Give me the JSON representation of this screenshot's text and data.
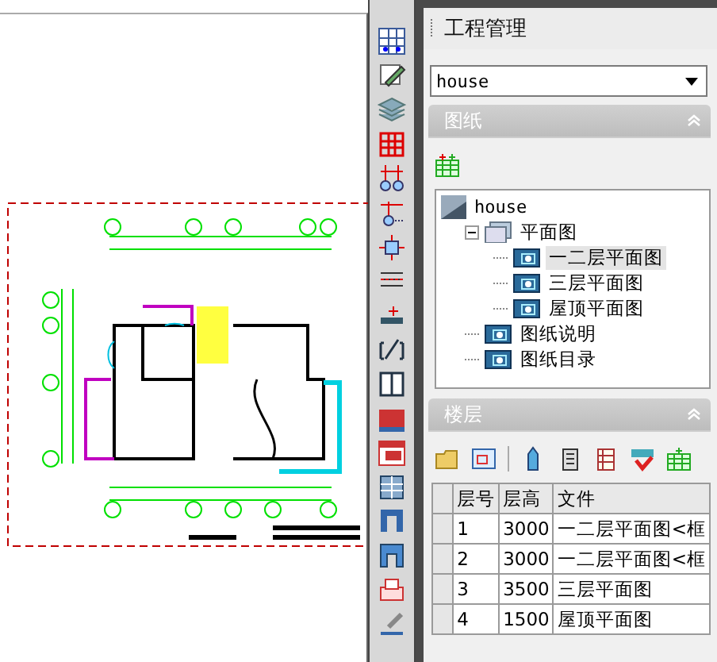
{
  "panel": {
    "title": "工程管理",
    "project": {
      "value": "house"
    },
    "sections": [
      {
        "kind": "drawings",
        "title": "图纸",
        "expanded": true,
        "tree": [
          {
            "label": "house",
            "kind": "project",
            "selected": false,
            "children": [
              {
                "label": "平面图",
                "kind": "folder",
                "expanded": true,
                "selected": false,
                "children": [
                  {
                    "label": "一二层平面图",
                    "kind": "sheet",
                    "selected": true
                  },
                  {
                    "label": "三层平面图",
                    "kind": "sheet",
                    "selected": false
                  },
                  {
                    "label": "屋顶平面图",
                    "kind": "sheet",
                    "selected": false
                  }
                ]
              },
              {
                "label": "图纸说明",
                "kind": "sheet",
                "selected": false
              },
              {
                "label": "图纸目录",
                "kind": "sheet",
                "selected": false
              }
            ]
          }
        ]
      },
      {
        "kind": "floors",
        "title": "楼层",
        "expanded": true,
        "table": {
          "columns": [
            "层号",
            "层高",
            "文件"
          ],
          "rows": [
            [
              "1",
              "3000",
              "一二层平面图<框"
            ],
            [
              "2",
              "3000",
              "一二层平面图<框"
            ],
            [
              "3",
              "3500",
              "三层平面图"
            ],
            [
              "4",
              "1500",
              "屋顶平面图"
            ]
          ]
        }
      }
    ]
  }
}
